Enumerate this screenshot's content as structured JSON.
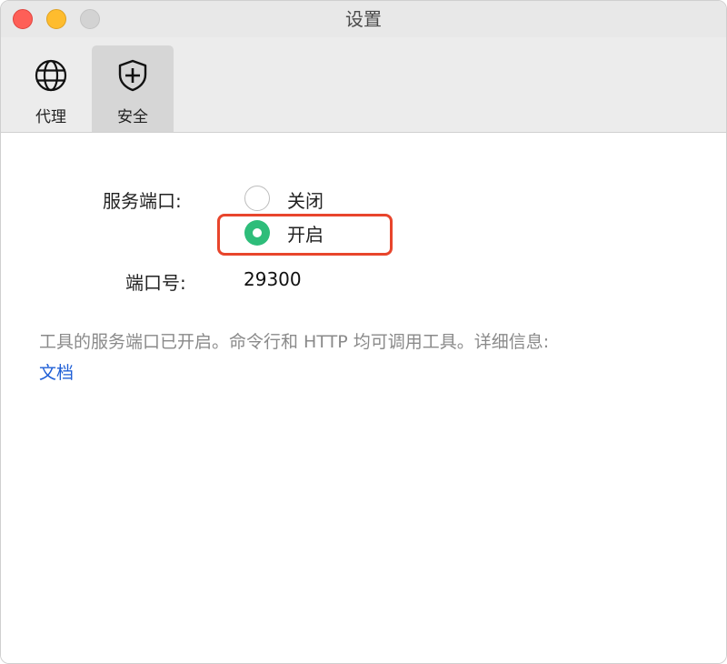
{
  "window": {
    "title": "设置"
  },
  "toolbar": {
    "tabs": [
      {
        "label": "代理",
        "icon": "globe-icon",
        "selected": false
      },
      {
        "label": "安全",
        "icon": "shield-plus-icon",
        "selected": true
      }
    ]
  },
  "form": {
    "service_port_label": "服务端口:",
    "options": [
      {
        "label": "关闭",
        "checked": false
      },
      {
        "label": "开启",
        "checked": true
      }
    ],
    "port_label": "端口号:",
    "port_value": "29300"
  },
  "description": {
    "text": "工具的服务端口已开启。命令行和 HTTP 均可调用工具。详细信息:",
    "link": "文档"
  },
  "colors": {
    "radio_checked": "#2ebd7a",
    "highlight_border": "#e8452c",
    "link": "#1f5fd6"
  }
}
